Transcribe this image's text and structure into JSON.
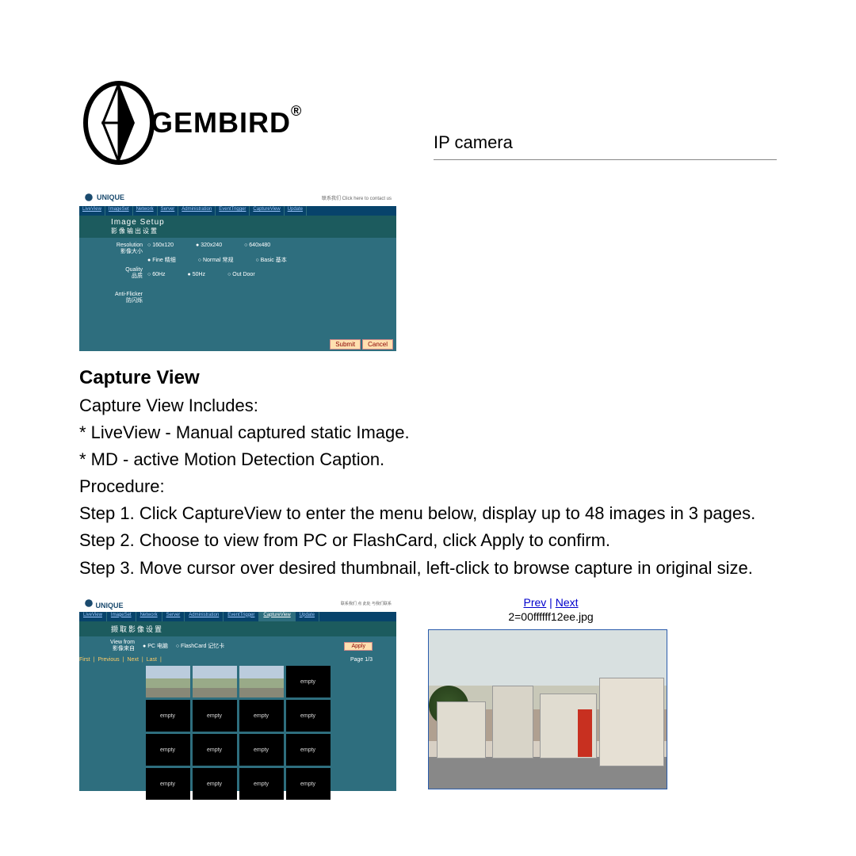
{
  "header": {
    "brand": "GEMBIRD",
    "product": "IP camera"
  },
  "screenshot1": {
    "brand": "UNIQUE",
    "topnote": "联系我们 Click here to contact us",
    "tabs": [
      "LiveView",
      "ImageSet",
      "Network",
      "Server",
      "Administration",
      "EventTrigger",
      "CaptureView",
      "Update"
    ],
    "title_en": "Image Setup",
    "title_cn": "影像输出设置",
    "rows": [
      {
        "label_en": "Resolution",
        "label_cn": "影像大小",
        "options": [
          "160x120",
          "320x240",
          "640x480"
        ],
        "selected": 1
      },
      {
        "label_en": "Quality",
        "label_cn": "品质",
        "options": [
          "Fine 精细",
          "Normal 常规",
          "Basic 基本"
        ],
        "selected": 0
      },
      {
        "label_en": "Anti-Flicker",
        "label_cn": "防闪烁",
        "options": [
          "60Hz",
          "50Hz",
          "Out Door"
        ],
        "selected": 1
      }
    ],
    "btn_submit": "Submit",
    "btn_cancel": "Cancel"
  },
  "content": {
    "heading": "Capture View",
    "includes_label": "Capture View Includes:",
    "bullet1": "* LiveView - Manual captured static Image.",
    "bullet2": "* MD - active Motion Detection Caption.",
    "procedure_label": "Procedure:",
    "step1": "Step 1. Click CaptureView to enter the menu below, display up to 48 images in 3 pages.",
    "step2": "Step 2. Choose to view from PC or FlashCard, click Apply to confirm.",
    "step3": "Step 3. Move cursor over desired thumbnail, left-click to browse capture in original size."
  },
  "screenshot2": {
    "brand": "UNIQUE",
    "topnote": "联系我们 点 此处 与我们联系",
    "tabs": [
      "LiveView",
      "ImageSet",
      "Network",
      "Server",
      "Administration",
      "EventTrigger",
      "CaptureView",
      "Update"
    ],
    "title": "撷取影像设置",
    "viewfrom_label": "View from\n影像来自",
    "opt_pc": "PC 电脑",
    "opt_flash": "FlashCard 记忆卡",
    "apply": "Apply",
    "nav": [
      "First",
      "Previous",
      "Next",
      "Last"
    ],
    "page": "Page 1/3",
    "thumbs": [
      "img",
      "img",
      "img",
      "empty",
      "empty",
      "empty",
      "empty",
      "empty",
      "empty",
      "empty",
      "empty",
      "empty",
      "empty",
      "empty",
      "empty",
      "empty"
    ],
    "empty_label": "empty"
  },
  "preview": {
    "prev": "Prev",
    "next": "Next",
    "sep": " | ",
    "filename": "2=00ffffff12ee.jpg"
  }
}
